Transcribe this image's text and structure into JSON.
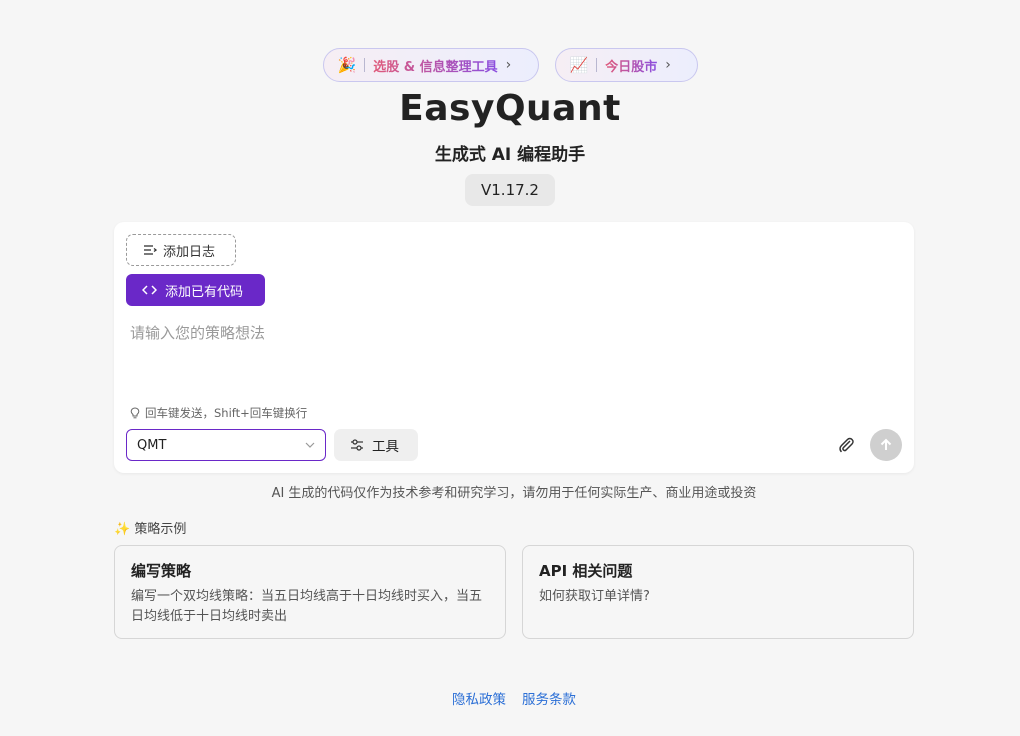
{
  "pills": [
    {
      "emoji": "🎉",
      "label": "选股 & 信息整理工具",
      "chevron": "›"
    },
    {
      "emoji": "📈",
      "label": "今日股市",
      "chevron": "›"
    }
  ],
  "app_title": "EasyQuant",
  "subtitle": "生成式 AI 编程助手",
  "version": "V1.17.2",
  "composer": {
    "add_log_label": "添加日志",
    "add_code_label": "添加已有代码",
    "placeholder": "请输入您的策略想法",
    "hint": "回车键发送，Shift+回车键换行",
    "platform_value": "QMT",
    "tools_label": "工具"
  },
  "disclaimer": "AI 生成的代码仅作为技术参考和研究学习，请勿用于任何实际生产、商业用途或投资",
  "examples": {
    "title": "✨ 策略示例",
    "items": [
      {
        "heading": "编写策略",
        "desc": "编写一个双均线策略：当五日均线高于十日均线时买入，当五日均线低于十日均线时卖出"
      },
      {
        "heading": "API 相关问题",
        "desc": "如何获取订单详情?"
      }
    ]
  },
  "footer": {
    "privacy": "隐私政策",
    "terms": "服务条款"
  },
  "colors": {
    "accent": "#6a28c8",
    "link": "#2b6fd6"
  }
}
